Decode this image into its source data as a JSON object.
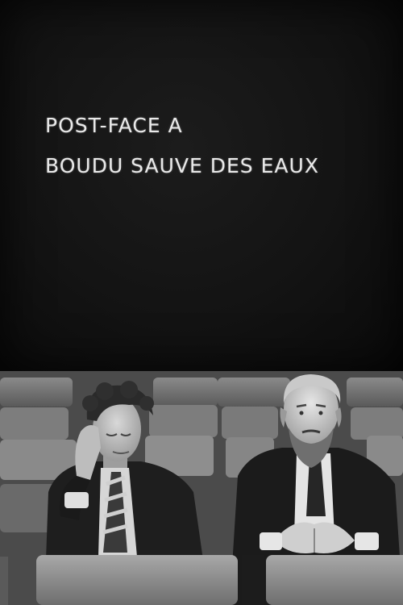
{
  "title_card": {
    "line1": "POST-FACE A",
    "line2": "BOUDU SAUVE DES EAUX"
  },
  "photo": {
    "description_icon": "photograph-two-men-in-cinema-seats"
  }
}
